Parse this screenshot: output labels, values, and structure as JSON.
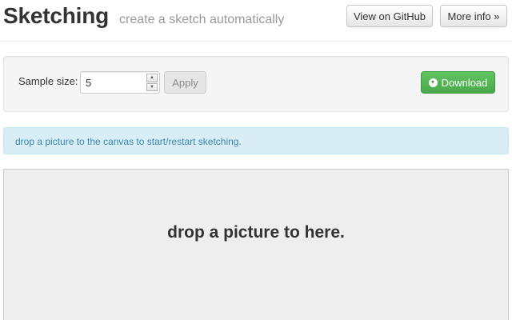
{
  "header": {
    "title": "Sketching",
    "tagline": "create a sketch automatically",
    "github_button": "View on GitHub",
    "more_info_button": "More info »"
  },
  "toolbar": {
    "sample_size_label": "Sample size:",
    "sample_size_value": "5",
    "apply_button": "Apply",
    "download_button": "Download",
    "download_icon": "download-circle-icon"
  },
  "alert": {
    "text": "drop a picture to the canvas to start/restart sketching."
  },
  "canvas": {
    "text": "drop a picture to here."
  },
  "colors": {
    "download_green": "#5bb75b",
    "alert_bg": "#d9edf7",
    "alert_text": "#3a87ad",
    "canvas_bg": "#eeeeee"
  }
}
